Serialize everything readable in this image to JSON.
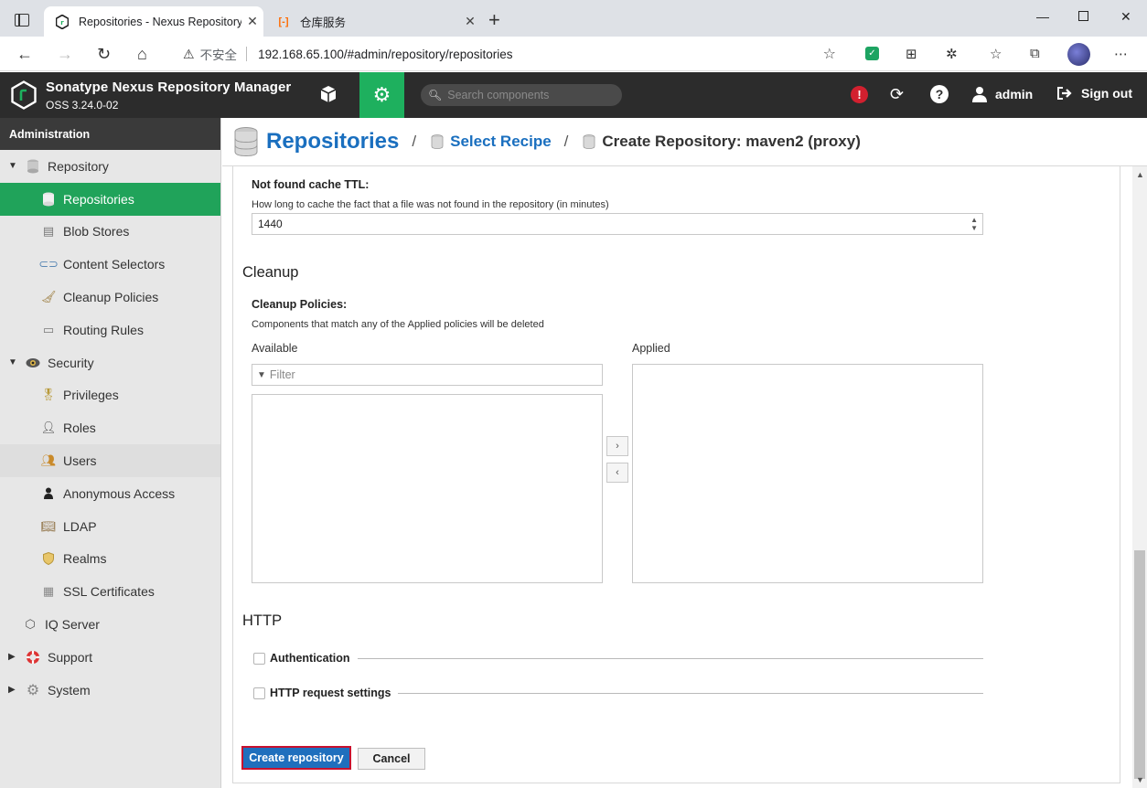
{
  "browser": {
    "tabs": [
      {
        "title": "Repositories - Nexus Repository M",
        "active": true
      },
      {
        "title": "仓库服务",
        "active": false
      }
    ],
    "security_label": "不安全",
    "url": "192.168.65.100/#admin/repository/repositories"
  },
  "header": {
    "product_name": "Sonatype Nexus Repository Manager",
    "version": "OSS 3.24.0-02",
    "search_placeholder": "Search components",
    "username": "admin",
    "signout_label": "Sign out",
    "accent_color": "#1eb05e",
    "alert_color": "#d2202f"
  },
  "sidebar": {
    "title": "Administration",
    "items": [
      {
        "label": "Repository",
        "level": 1,
        "expanded": true,
        "icon": "database-icon"
      },
      {
        "label": "Repositories",
        "level": 2,
        "selected": true,
        "icon": "database-icon"
      },
      {
        "label": "Blob Stores",
        "level": 2,
        "icon": "server-icon"
      },
      {
        "label": "Content Selectors",
        "level": 2,
        "icon": "selector-icon"
      },
      {
        "label": "Cleanup Policies",
        "level": 2,
        "icon": "broom-icon"
      },
      {
        "label": "Routing Rules",
        "level": 2,
        "icon": "router-icon"
      },
      {
        "label": "Security",
        "level": 1,
        "expanded": true,
        "icon": "security-eye-icon"
      },
      {
        "label": "Privileges",
        "level": 2,
        "icon": "medal-icon"
      },
      {
        "label": "Roles",
        "level": 2,
        "icon": "role-icon"
      },
      {
        "label": "Users",
        "level": 2,
        "hover": true,
        "icon": "users-icon"
      },
      {
        "label": "Anonymous Access",
        "level": 2,
        "icon": "user-icon"
      },
      {
        "label": "LDAP",
        "level": 2,
        "icon": "book-icon"
      },
      {
        "label": "Realms",
        "level": 2,
        "icon": "shield-icon"
      },
      {
        "label": "SSL Certificates",
        "level": 2,
        "icon": "certificate-icon"
      },
      {
        "label": "IQ Server",
        "level": 1,
        "noarrow": true,
        "icon": "iq-icon"
      },
      {
        "label": "Support",
        "level": 1,
        "icon": "lifebuoy-icon"
      },
      {
        "label": "System",
        "level": 1,
        "icon": "gear-icon"
      }
    ],
    "selected_color": "#20a35a"
  },
  "breadcrumb": {
    "root": "Repositories",
    "middle": "Select Recipe",
    "current": "Create Repository: maven2 (proxy)"
  },
  "form": {
    "not_found_ttl": {
      "label": "Not found cache TTL:",
      "help": "How long to cache the fact that a file was not found in the repository (in minutes)",
      "value": "1440"
    },
    "cleanup": {
      "section_title": "Cleanup",
      "label": "Cleanup Policies:",
      "help": "Components that match any of the Applied policies will be deleted",
      "available_label": "Available",
      "applied_label": "Applied",
      "filter_placeholder": "Filter",
      "available_items": [],
      "applied_items": []
    },
    "http": {
      "section_title": "HTTP",
      "authentication_label": "Authentication",
      "authentication_checked": false,
      "request_settings_label": "HTTP request settings",
      "request_settings_checked": false
    },
    "create_button": "Create repository",
    "cancel_button": "Cancel"
  }
}
